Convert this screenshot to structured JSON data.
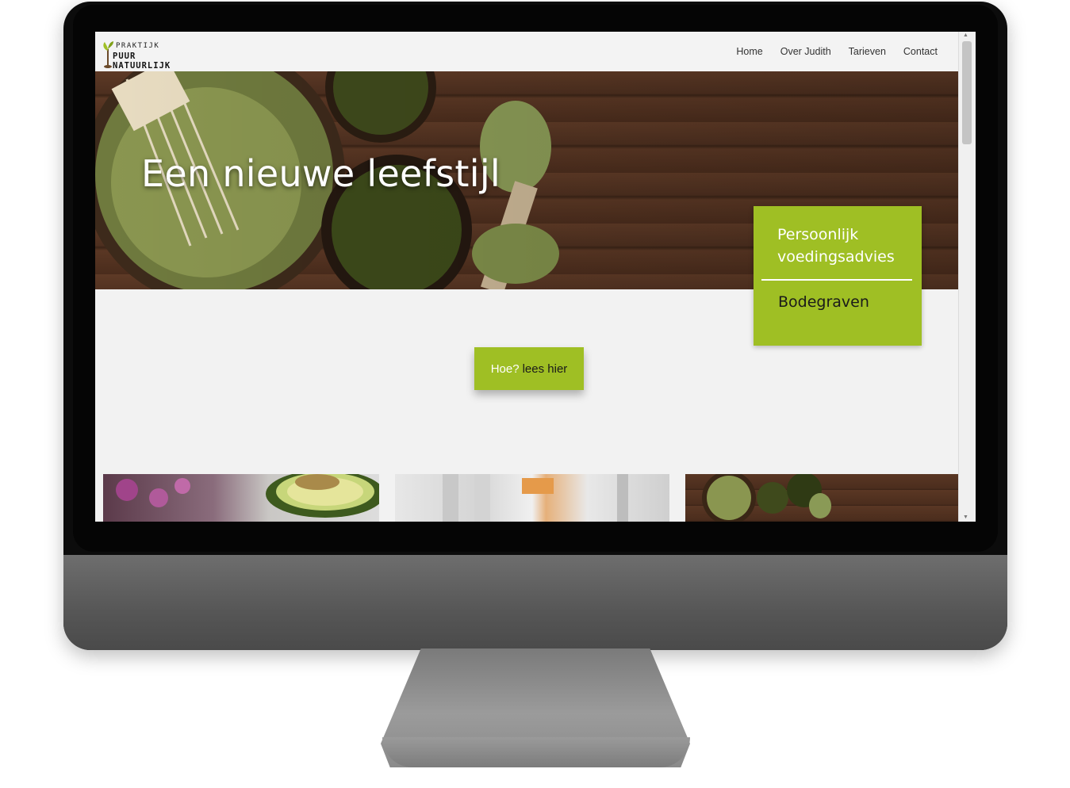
{
  "site": {
    "logo": {
      "line1": "PRAKTIJK",
      "line2": "PUUR NATUURLIJK"
    },
    "nav": [
      {
        "label": "Home"
      },
      {
        "label": "Over Judith"
      },
      {
        "label": "Tarieven"
      },
      {
        "label": "Contact"
      }
    ],
    "hero": {
      "title": "Een nieuwe leefstijl"
    },
    "info_card": {
      "line1": "Persoonlijk voedingsadvies",
      "line2": "Bodegraven"
    },
    "cta": {
      "part1": "Hoe?",
      "part2": "lees hier"
    }
  },
  "colors": {
    "accent": "#9fbf24",
    "wood": "#4d2f1f"
  }
}
